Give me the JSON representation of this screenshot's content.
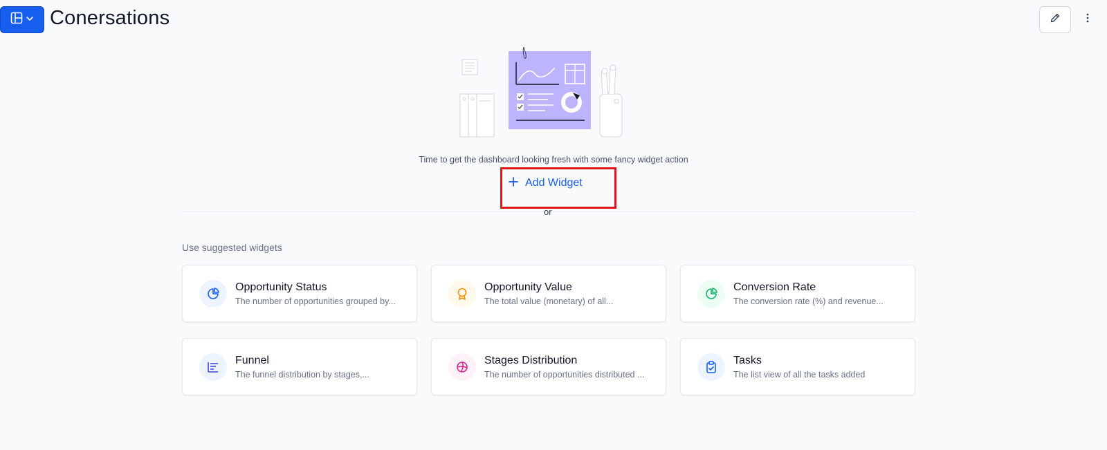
{
  "header": {
    "title": "Conersations",
    "layout_button_icon": "layout-grid-icon",
    "edit_button_icon": "pencil-icon",
    "more_button_icon": "more-vertical-icon"
  },
  "empty_state": {
    "message": "Time to get the dashboard looking fresh with some fancy widget action",
    "add_widget_label": "Add Widget",
    "or_label": "or"
  },
  "suggestions": {
    "label": "Use suggested widgets",
    "cards": [
      {
        "title": "Opportunity Status",
        "description": "The number of opportunities grouped by...",
        "icon": "pie-chart-icon",
        "color": "#155eef",
        "bg": "#eef4ff"
      },
      {
        "title": "Opportunity Value",
        "description": "The total value (monetary) of all...",
        "icon": "award-icon",
        "color": "#f79009",
        "bg": "#fffaeb"
      },
      {
        "title": "Conversion Rate",
        "description": "The conversion rate (%) and revenue...",
        "icon": "pie-chart-icon",
        "color": "#12b76a",
        "bg": "#ecfdf3"
      },
      {
        "title": "Funnel",
        "description": "The funnel distribution by stages,...",
        "icon": "funnel-icon",
        "color": "#444ce7",
        "bg": "#eef4ff"
      },
      {
        "title": "Stages Distribution",
        "description": "The number of opportunities distributed ...",
        "icon": "globe-chart-icon",
        "color": "#dd2590",
        "bg": "#fdf2fa"
      },
      {
        "title": "Tasks",
        "description": "The list view of all the tasks added",
        "icon": "clipboard-check-icon",
        "color": "#155eef",
        "bg": "#eef4ff"
      }
    ]
  },
  "colors": {
    "accent": "#155eef",
    "highlight": "#e4161b",
    "illustration_purple": "#bdb4fe"
  }
}
